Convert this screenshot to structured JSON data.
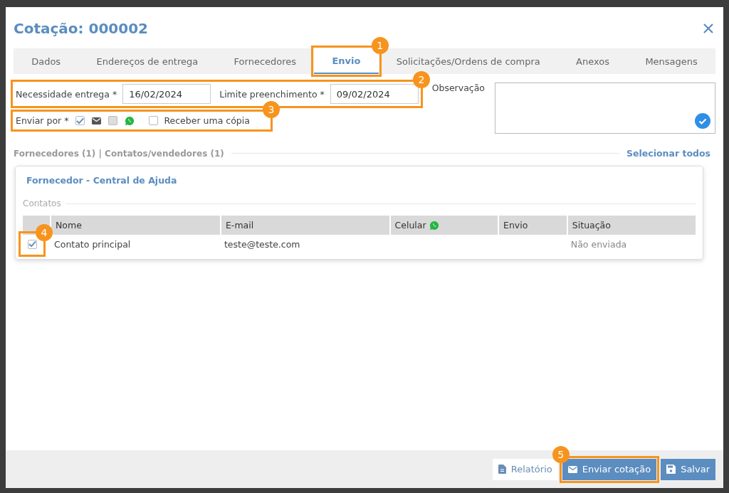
{
  "window": {
    "title": "Cotação: 000002"
  },
  "tabs": [
    {
      "label": "Dados",
      "selected": false
    },
    {
      "label": "Endereços de entrega",
      "selected": false
    },
    {
      "label": "Fornecedores",
      "selected": false
    },
    {
      "label": "Envio",
      "selected": true,
      "annotation": "1"
    },
    {
      "label": "Solicitações/Ordens de compra",
      "selected": false
    },
    {
      "label": "Anexos",
      "selected": false
    },
    {
      "label": "Mensagens",
      "selected": false
    }
  ],
  "dates": {
    "annotation": "2",
    "fields": [
      {
        "label": "Necessidade entrega *",
        "value": "16/02/2024"
      },
      {
        "label": "Limite preenchimento *",
        "value": "09/02/2024"
      }
    ]
  },
  "observation": {
    "label": "Observação",
    "checked": true
  },
  "send_by": {
    "label": "Enviar por *",
    "annotation": "3",
    "options": [
      {
        "kind": "email",
        "checked": true,
        "disabled": false
      },
      {
        "kind": "whatsapp",
        "checked": false,
        "disabled": true
      }
    ],
    "copy": {
      "label": "Receber uma cópia",
      "checked": false
    }
  },
  "section": {
    "title": "Fornecedores (1) | Contatos/vendedores (1)",
    "select_all": "Selecionar todos"
  },
  "supplier": {
    "title": "Fornecedor - Central de Ajuda",
    "contacts_label": "Contatos",
    "columns": [
      {
        "label": "Nome"
      },
      {
        "label": "E-mail"
      },
      {
        "label": "Celular"
      },
      {
        "label": "Envio"
      },
      {
        "label": "Situação"
      }
    ],
    "rows": [
      {
        "checked": true,
        "annotation": "4",
        "cells": [
          "Contato principal",
          "teste@teste.com",
          "",
          "",
          "Não enviada"
        ]
      }
    ]
  },
  "footer": {
    "buttons": [
      {
        "kind": "link",
        "label": "Relatório"
      },
      {
        "kind": "primary",
        "label": "Enviar cotação",
        "annotation": "5"
      },
      {
        "kind": "primary",
        "label": "Salvar"
      }
    ]
  }
}
